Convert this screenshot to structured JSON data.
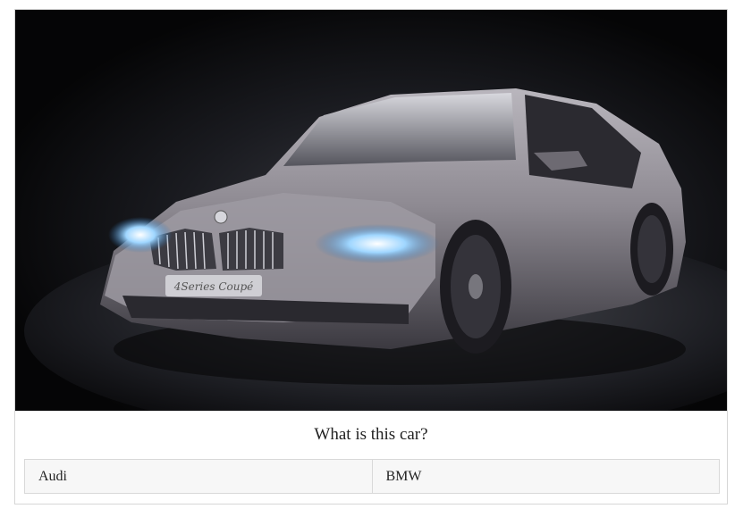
{
  "image": {
    "badge_text": "4Series Coupé"
  },
  "question": {
    "text": "What is this car?"
  },
  "answers": [
    {
      "label": "Audi"
    },
    {
      "label": "BMW"
    }
  ]
}
